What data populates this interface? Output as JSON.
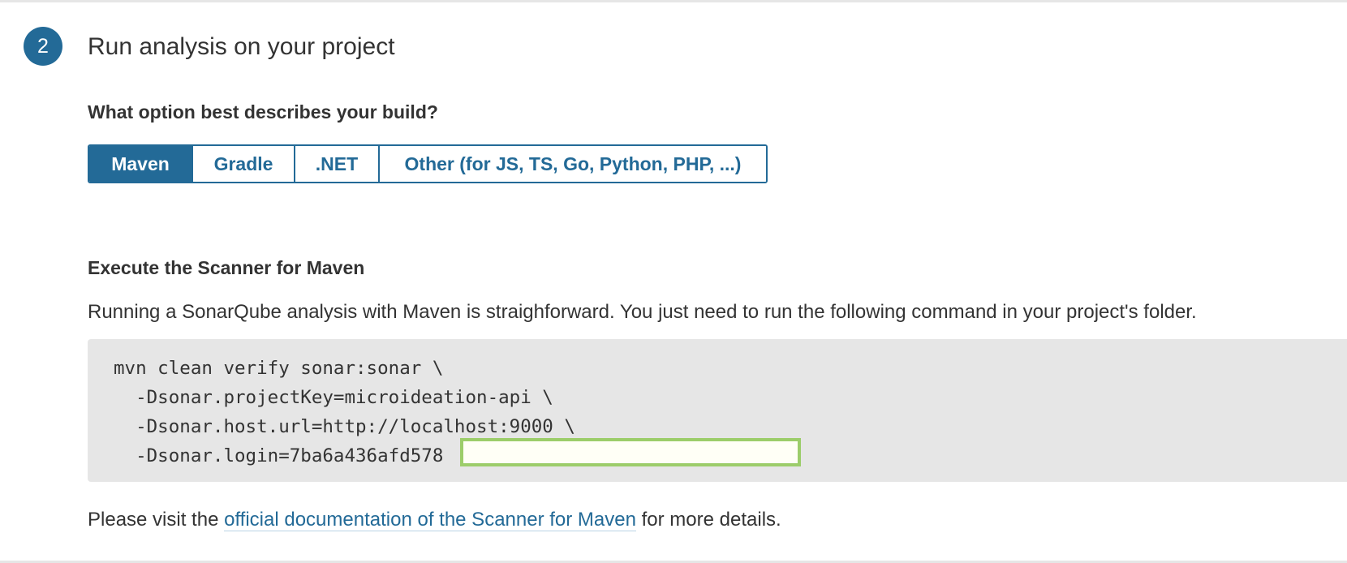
{
  "step": {
    "number": "2",
    "title": "Run analysis on your project"
  },
  "build_question": "What option best describes your build?",
  "build_options": [
    {
      "label": "Maven",
      "selected": true
    },
    {
      "label": "Gradle",
      "selected": false
    },
    {
      "label": ".NET",
      "selected": false
    },
    {
      "label": "Other (for JS, TS, Go, Python, PHP, ...)",
      "selected": false
    }
  ],
  "scanner": {
    "heading": "Execute the Scanner for Maven",
    "description": "Running a SonarQube analysis with Maven is straighforward. You just need to run the following command in your project's folder.",
    "command_lines": [
      "mvn clean verify sonar:sonar \\",
      "  -Dsonar.projectKey=microideation-api \\",
      "  -Dsonar.host.url=http://localhost:9000 \\",
      "  -Dsonar.login=7ba6a436afd578"
    ]
  },
  "footer": {
    "prefix": "Please visit the ",
    "link_text": "official documentation of the Scanner for Maven",
    "suffix": " for more details."
  },
  "colors": {
    "accent": "#236a97",
    "code_background": "#e6e6e6",
    "redaction_border": "#9ccd6a"
  }
}
